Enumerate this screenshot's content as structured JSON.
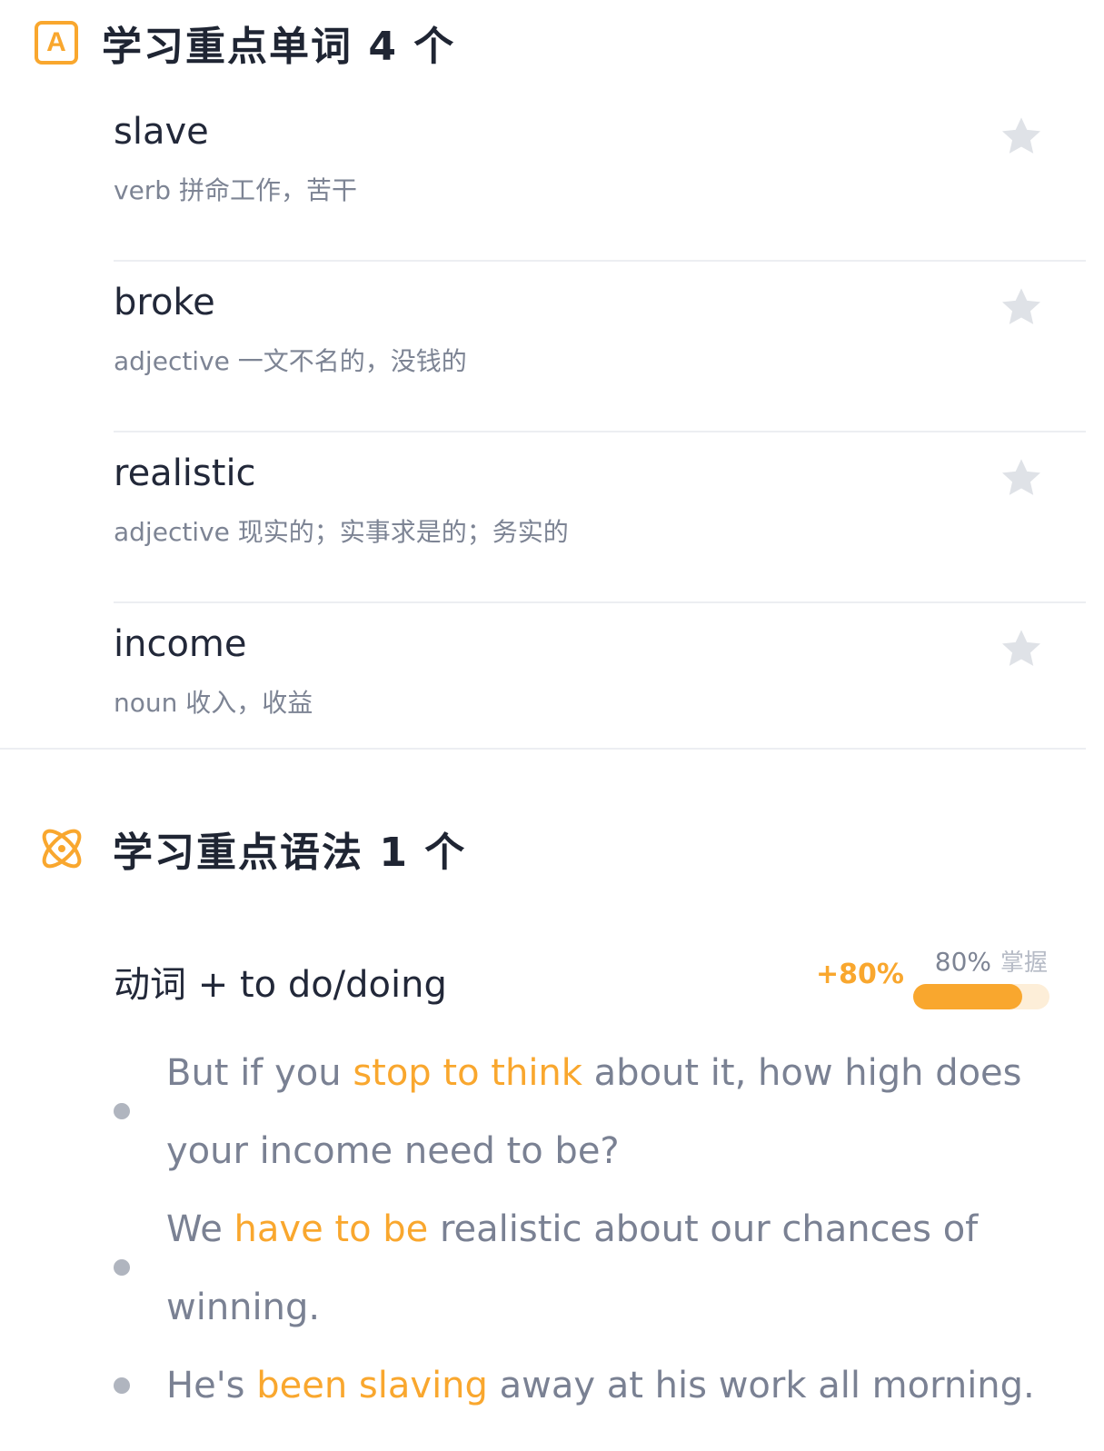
{
  "vocab_section": {
    "icon": "letter-a-icon",
    "title": "学习重点单词 4 个",
    "words": [
      {
        "word": "slave",
        "definition": "verb 拼命工作，苦干"
      },
      {
        "word": "broke",
        "definition": "adjective 一文不名的，没钱的"
      },
      {
        "word": "realistic",
        "definition": "adjective 现实的；实事求是的；务实的"
      },
      {
        "word": "income",
        "definition": "noun 收入，收益"
      }
    ]
  },
  "grammar_section": {
    "icon": "atom-icon",
    "title": "学习重点语法 1 个",
    "point": {
      "title": "动词 + to do/doing",
      "gain": "+80%",
      "percent": "80%",
      "mastery_label": "掌握",
      "progress_fraction": 0.8
    },
    "examples": [
      {
        "before": "But if you ",
        "highlight": "stop to think",
        "after": " about it, how high does your income need to be?"
      },
      {
        "before": "We ",
        "highlight": "have to be",
        "after": " realistic about our chances of winning."
      },
      {
        "before": "He's ",
        "highlight": "been slaving",
        "after": " away at his work all morning."
      }
    ]
  },
  "colors": {
    "accent": "#f9a72e",
    "text": "#222839",
    "muted": "#7d8494",
    "star": "#dfe2e7",
    "divider": "#eceef2"
  }
}
